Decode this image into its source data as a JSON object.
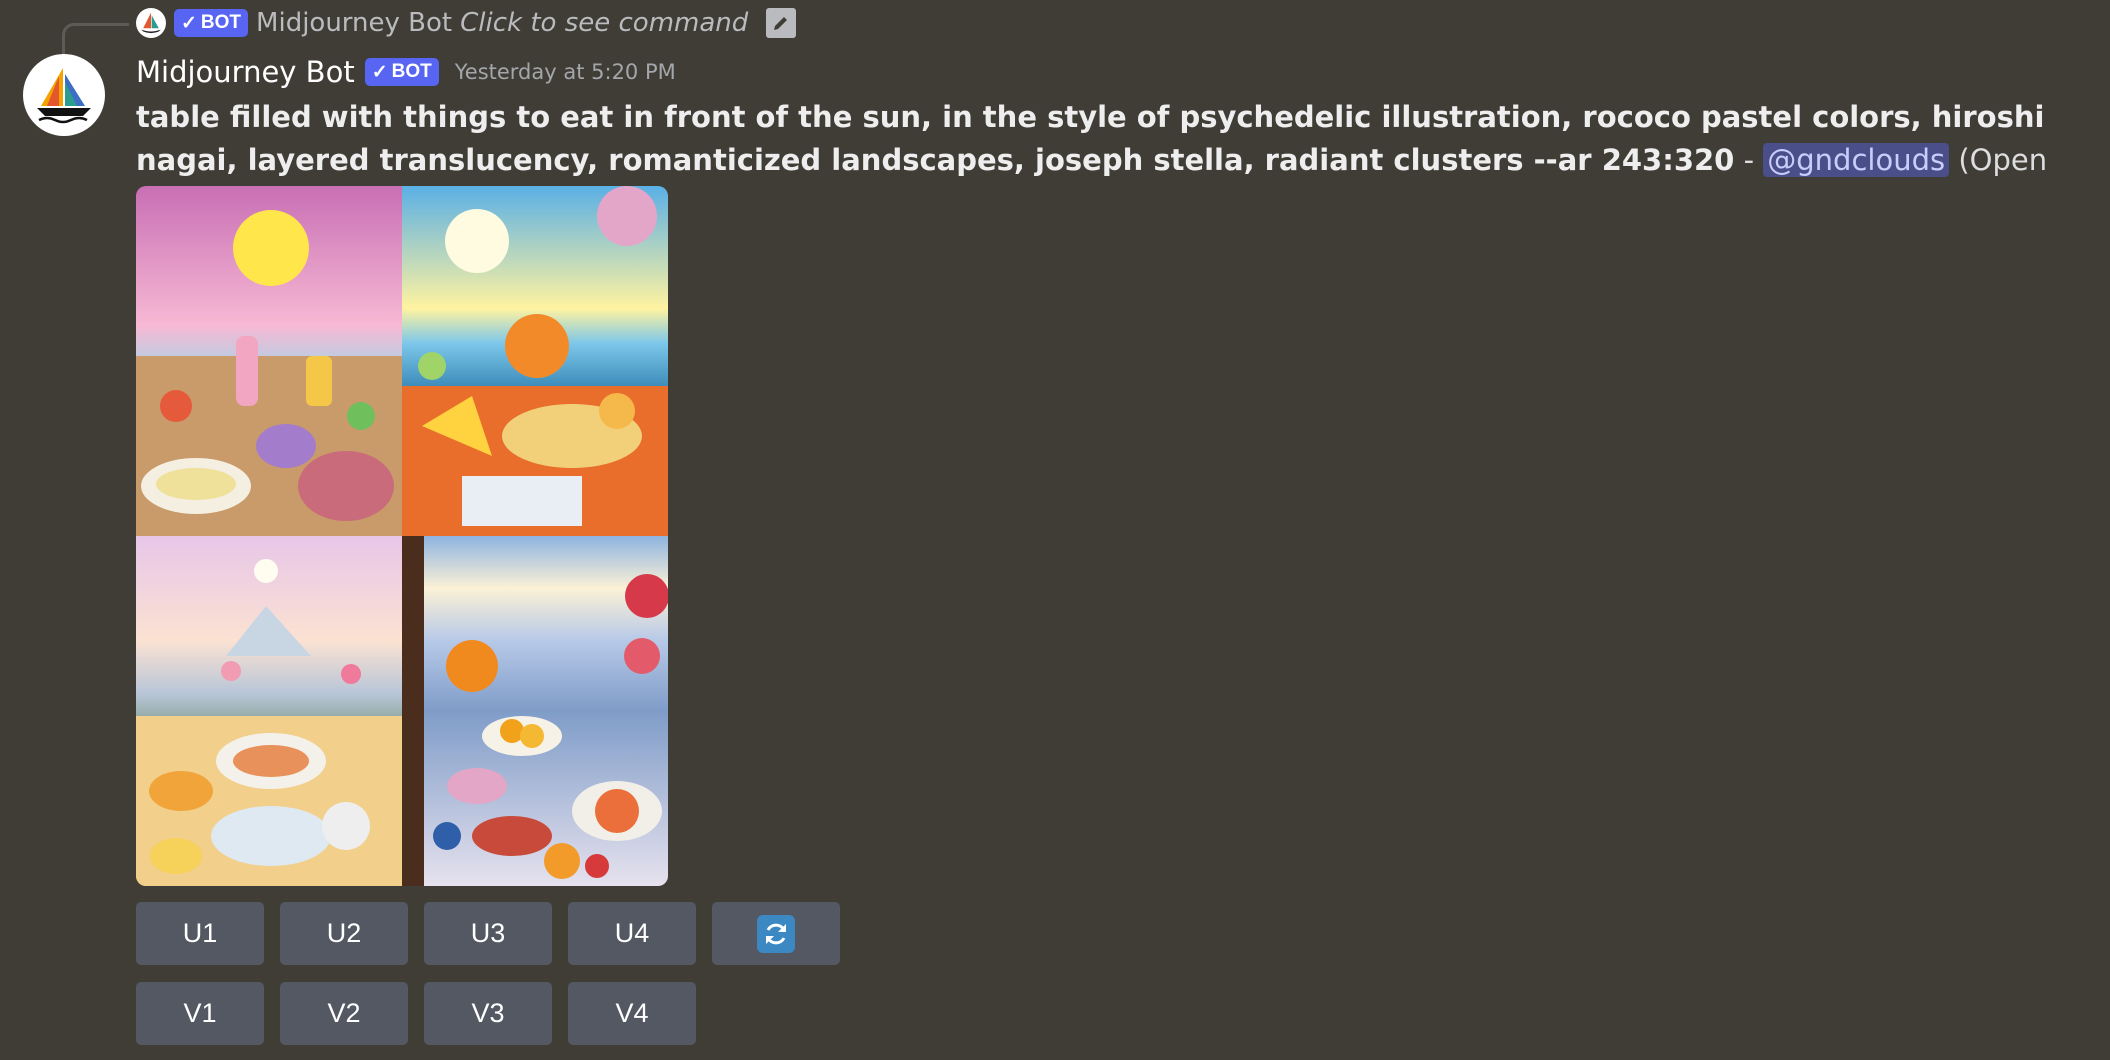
{
  "reply": {
    "bot_name": "Midjourney Bot",
    "badge": "BOT",
    "command_text": "Click to see command"
  },
  "message": {
    "author": "Midjourney Bot",
    "badge": "BOT",
    "timestamp": "Yesterday at 5:20 PM",
    "prompt": "table filled with things to eat in front of the sun, in the style of psychedelic illustration, rococo pastel colors, hiroshi nagai, layered translucency, romanticized landscapes, joseph stella, radiant clusters --ar 243:320",
    "separator": " - ",
    "mention": "@gndclouds",
    "suffix": " (Open on website for full quality) (fast)"
  },
  "images": [
    "generated-image-1",
    "generated-image-2",
    "generated-image-3",
    "generated-image-4"
  ],
  "buttons": {
    "upscale": [
      "U1",
      "U2",
      "U3",
      "U4"
    ],
    "reroll_icon": "refresh-icon",
    "variation": [
      "V1",
      "V2",
      "V3",
      "V4"
    ]
  },
  "colors": {
    "background": "#403d36",
    "badge": "#5865f2",
    "button": "#545862",
    "mention_bg": "#4a4f8a"
  }
}
